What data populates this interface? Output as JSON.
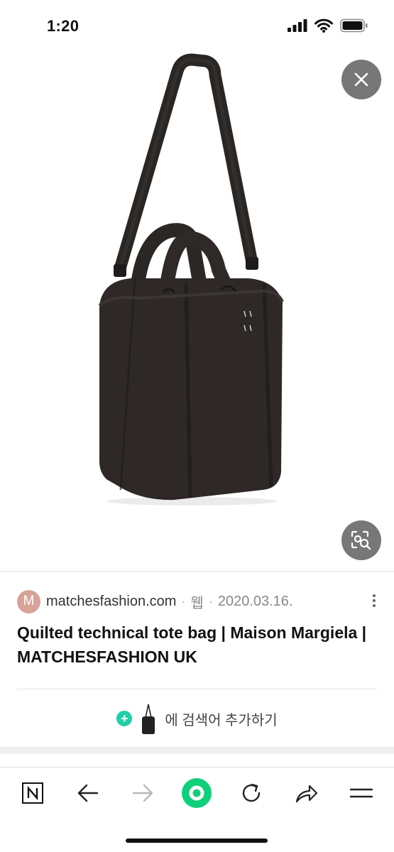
{
  "status_bar": {
    "time": "1:20"
  },
  "viewer": {
    "close_icon": "close-icon",
    "lens_icon": "image-search-icon"
  },
  "result": {
    "source_initial": "M",
    "source_domain": "matchesfashion.com",
    "source_type": "웹",
    "source_date": "2020.03.16.",
    "title": "Quilted technical tote bag | Maison Margiela | MATCHESFASHION UK"
  },
  "add_keyword": {
    "label": "에 검색어 추가하기"
  },
  "toolbar": {
    "items": [
      "naver-home-icon",
      "back-arrow-icon",
      "forward-arrow-icon",
      "green-dot-icon",
      "refresh-icon",
      "share-icon",
      "menu-icon"
    ]
  },
  "colors": {
    "accent_green": "#1fcfa7",
    "toolbar_green": "#0fd07a",
    "overlay_button": "#777777",
    "avatar": "#d7a397"
  }
}
